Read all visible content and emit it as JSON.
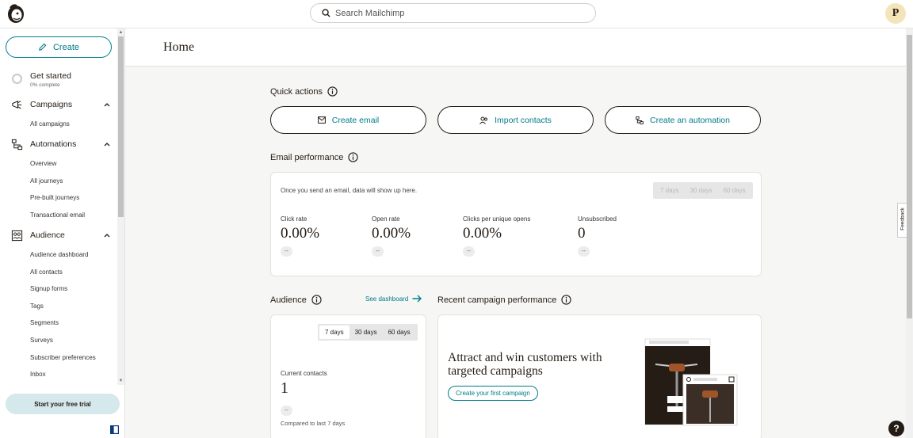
{
  "search": {
    "placeholder": "Search Mailchimp"
  },
  "user": {
    "initial": "P"
  },
  "sidebar": {
    "create_label": "Create",
    "get_started": {
      "title": "Get started",
      "progress": "0% complete"
    },
    "groups": [
      {
        "label": "Campaigns",
        "icon": "megaphone-icon",
        "items": [
          "All campaigns"
        ]
      },
      {
        "label": "Automations",
        "icon": "automation-flow-icon",
        "items": [
          "Overview",
          "All journeys",
          "Pre-built journeys",
          "Transactional email"
        ]
      },
      {
        "label": "Audience",
        "icon": "audience-icon",
        "items": [
          "Audience dashboard",
          "All contacts",
          "Signup forms",
          "Tags",
          "Segments",
          "Surveys",
          "Subscriber preferences",
          "Inbox"
        ]
      }
    ],
    "trial_label": "Start your free trial"
  },
  "page": {
    "title": "Home"
  },
  "quick_actions": {
    "title": "Quick actions",
    "buttons": [
      {
        "label": "Create email",
        "icon": "envelope-icon"
      },
      {
        "label": "Import contacts",
        "icon": "contacts-icon"
      },
      {
        "label": "Create an automation",
        "icon": "automation-icon"
      }
    ]
  },
  "email_performance": {
    "title": "Email performance",
    "note": "Once you send an email, data will show up here.",
    "ranges": [
      "7 days",
      "30 days",
      "60 days"
    ],
    "metrics": [
      {
        "label": "Click rate",
        "value": "0.00%",
        "change": "--"
      },
      {
        "label": "Open rate",
        "value": "0.00%",
        "change": "--"
      },
      {
        "label": "Clicks per unique opens",
        "value": "0.00%",
        "change": "--"
      },
      {
        "label": "Unsubscribed",
        "value": "0",
        "change": "--"
      }
    ]
  },
  "audience": {
    "title": "Audience",
    "see_dashboard": "See dashboard",
    "ranges": [
      "7 days",
      "30 days",
      "60 days"
    ],
    "selected_range": "7 days",
    "current_label": "Current contacts",
    "current_value": "1",
    "change": "--",
    "compare": "Compared to last 7 days"
  },
  "recent_campaign": {
    "title": "Recent campaign performance",
    "promo_title": "Attract and win customers with targeted campaigns",
    "promo_button": "Create your first campaign"
  },
  "feedback_label": "Feedback",
  "help_label": "?",
  "colors": {
    "accent": "#007c89",
    "text": "#241c15",
    "trial_bg": "#d5e8ec",
    "avatar_bg": "#f4e4b9"
  }
}
